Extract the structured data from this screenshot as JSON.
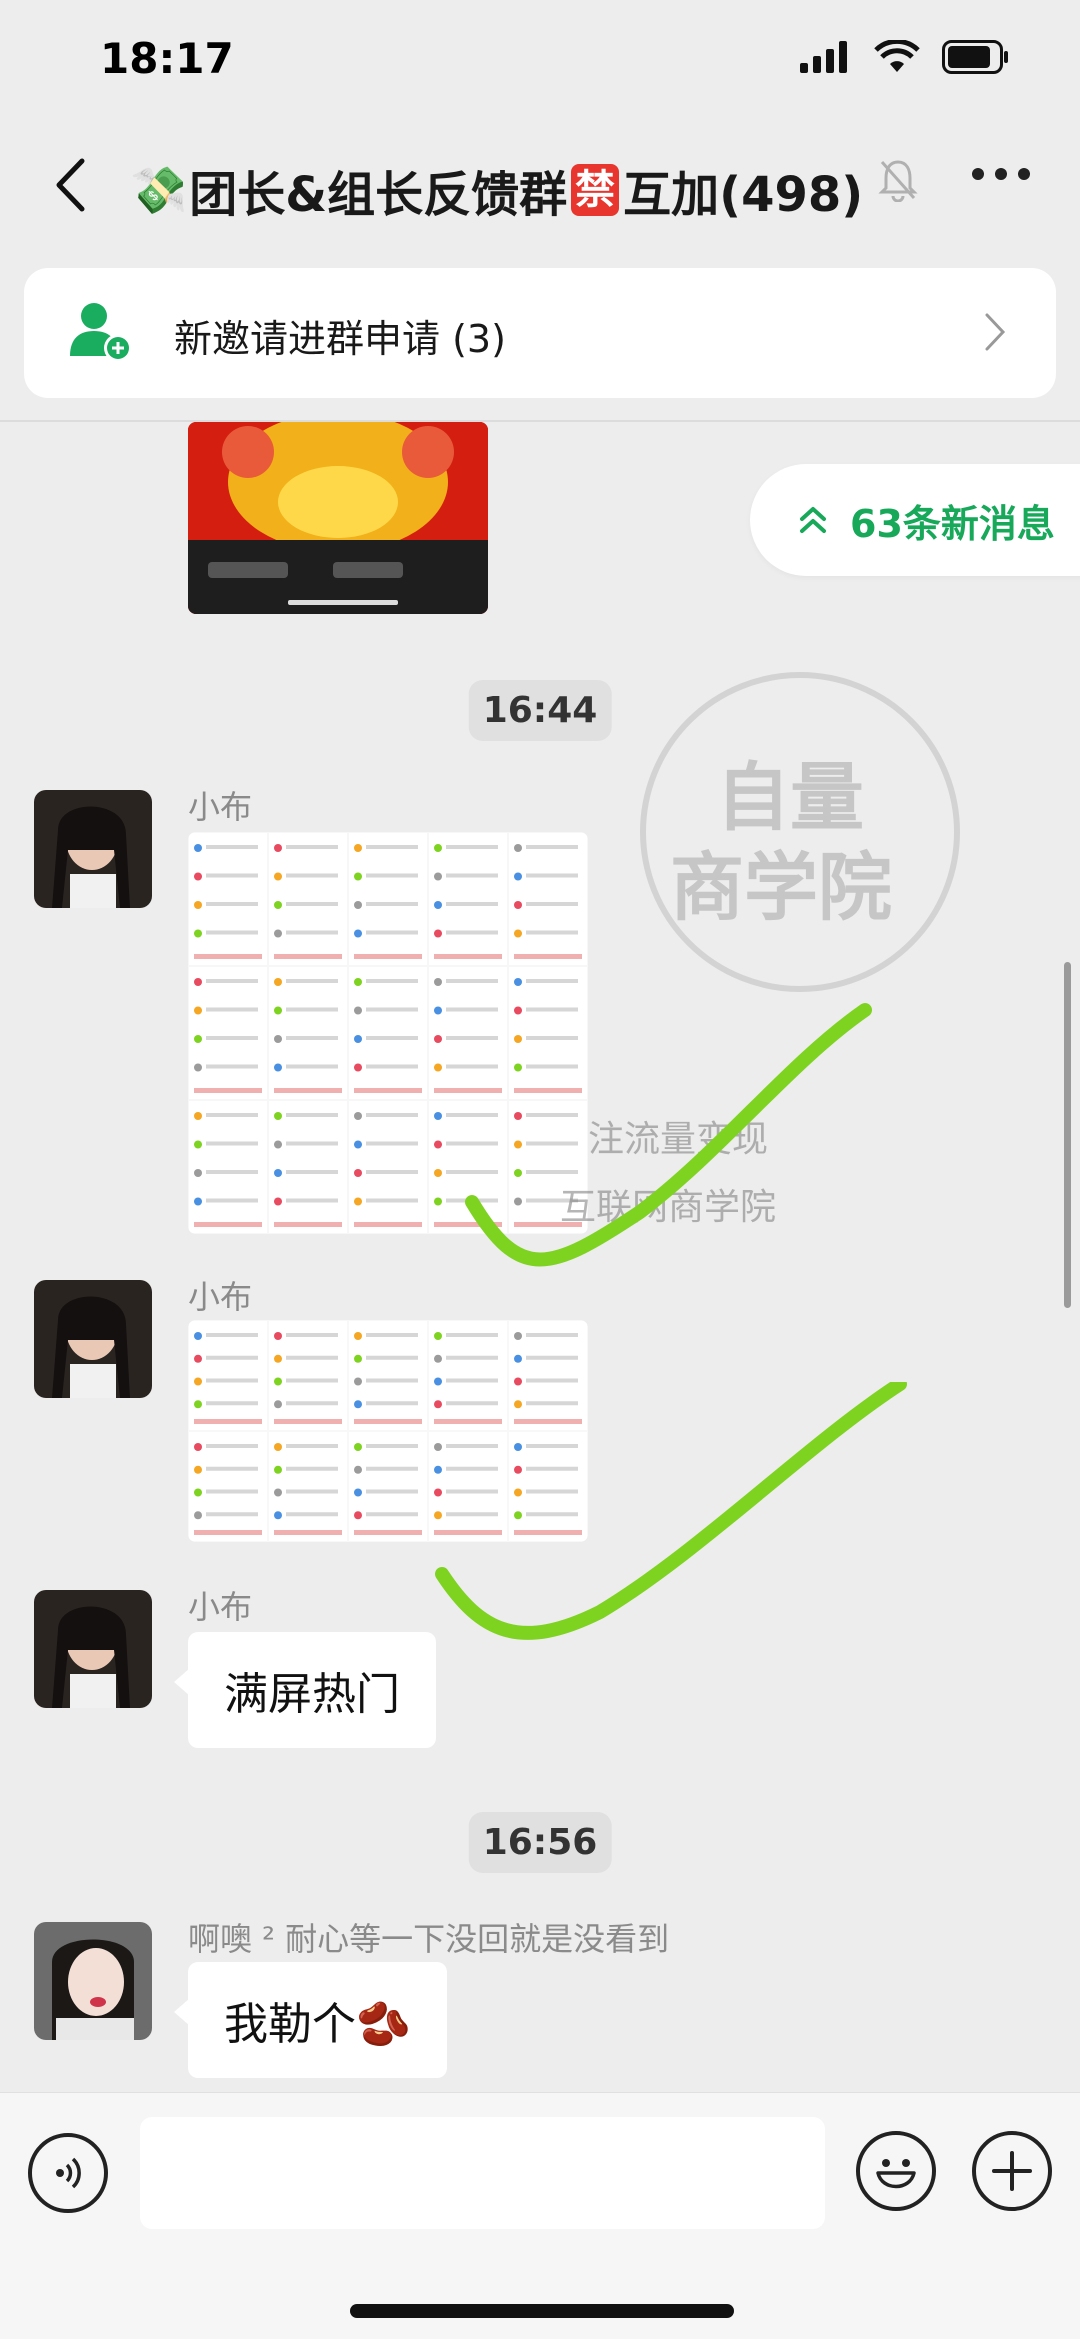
{
  "status_bar": {
    "time": "18:17"
  },
  "nav": {
    "money_emoji": "💸",
    "title_part1": "团长&组长反馈群",
    "ban_badge": "禁",
    "title_part2": "互加(498)"
  },
  "invite_banner": {
    "label": "新邀请进群申请 (3)"
  },
  "new_messages": {
    "label": "63条新消息"
  },
  "messages": [
    {
      "type": "time",
      "text": "16:44"
    },
    {
      "type": "image",
      "sender": "小布"
    },
    {
      "type": "image",
      "sender": "小布"
    },
    {
      "type": "text",
      "sender": "小布",
      "text": "满屏热门"
    },
    {
      "type": "time",
      "text": "16:56"
    },
    {
      "type": "text",
      "sender": "啊噢 ² 耐心等一下没回就是没看到",
      "text": "我勒个🫘"
    }
  ],
  "watermark": {
    "seal_line1": "自量",
    "seal_line2": "商学院",
    "line1": "注流量变现",
    "line2": "互联网商学院"
  },
  "colors": {
    "accent_green": "#17a85a",
    "check_green": "#7ed321",
    "ban_red": "#e8352d"
  }
}
